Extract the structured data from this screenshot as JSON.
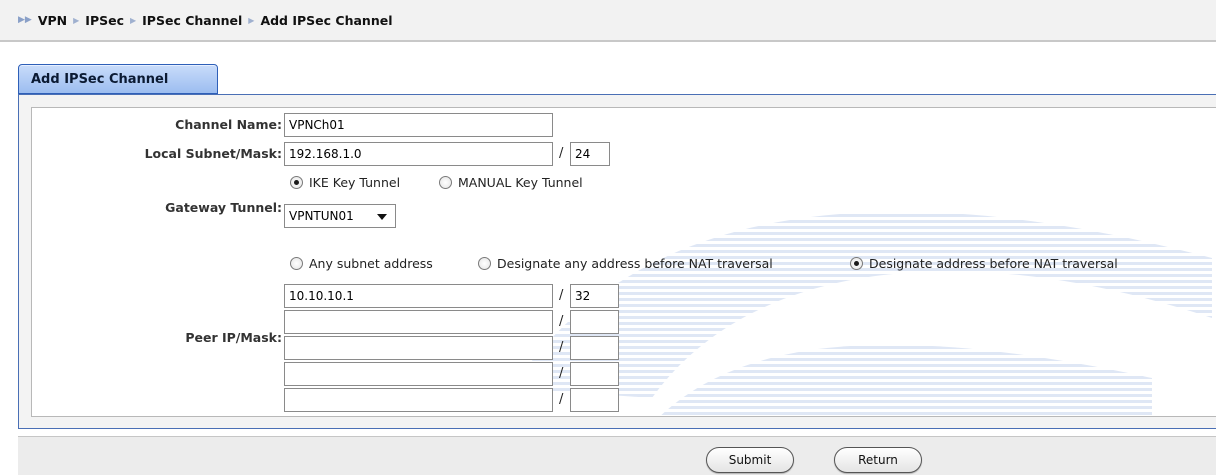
{
  "breadcrumb": {
    "items": [
      "VPN",
      "IPSec",
      "IPSec Channel",
      "Add IPSec Channel"
    ]
  },
  "tab": {
    "label": "Add IPSec Channel"
  },
  "form": {
    "channel_name": {
      "label": "Channel Name:",
      "value": "VPNCh01"
    },
    "local_subnet": {
      "label": "Local Subnet/Mask:",
      "ip": "192.168.1.0",
      "mask": "24",
      "slash": "/"
    },
    "gateway_tunnel": {
      "label": "Gateway Tunnel:",
      "options": [
        "IKE Key Tunnel",
        "MANUAL Key Tunnel"
      ],
      "selected": "IKE Key Tunnel",
      "tunnel_select": "VPNTUN01"
    },
    "peer": {
      "label": "Peer IP/Mask:",
      "options": [
        "Any subnet address",
        "Designate any address before NAT traversal",
        "Designate address before NAT traversal"
      ],
      "selected": "Designate address before NAT traversal",
      "rows": [
        {
          "ip": "10.10.10.1",
          "mask": "32"
        },
        {
          "ip": "",
          "mask": ""
        },
        {
          "ip": "",
          "mask": ""
        },
        {
          "ip": "",
          "mask": ""
        },
        {
          "ip": "",
          "mask": ""
        }
      ],
      "slash": "/"
    }
  },
  "buttons": {
    "submit": "Submit",
    "return": "Return"
  },
  "colors": {
    "tab_border": "#2e5fb8",
    "tab_bg": "#9cbdf0",
    "panel_border": "#4a6fb5",
    "watermark": "#dfe7f5"
  }
}
